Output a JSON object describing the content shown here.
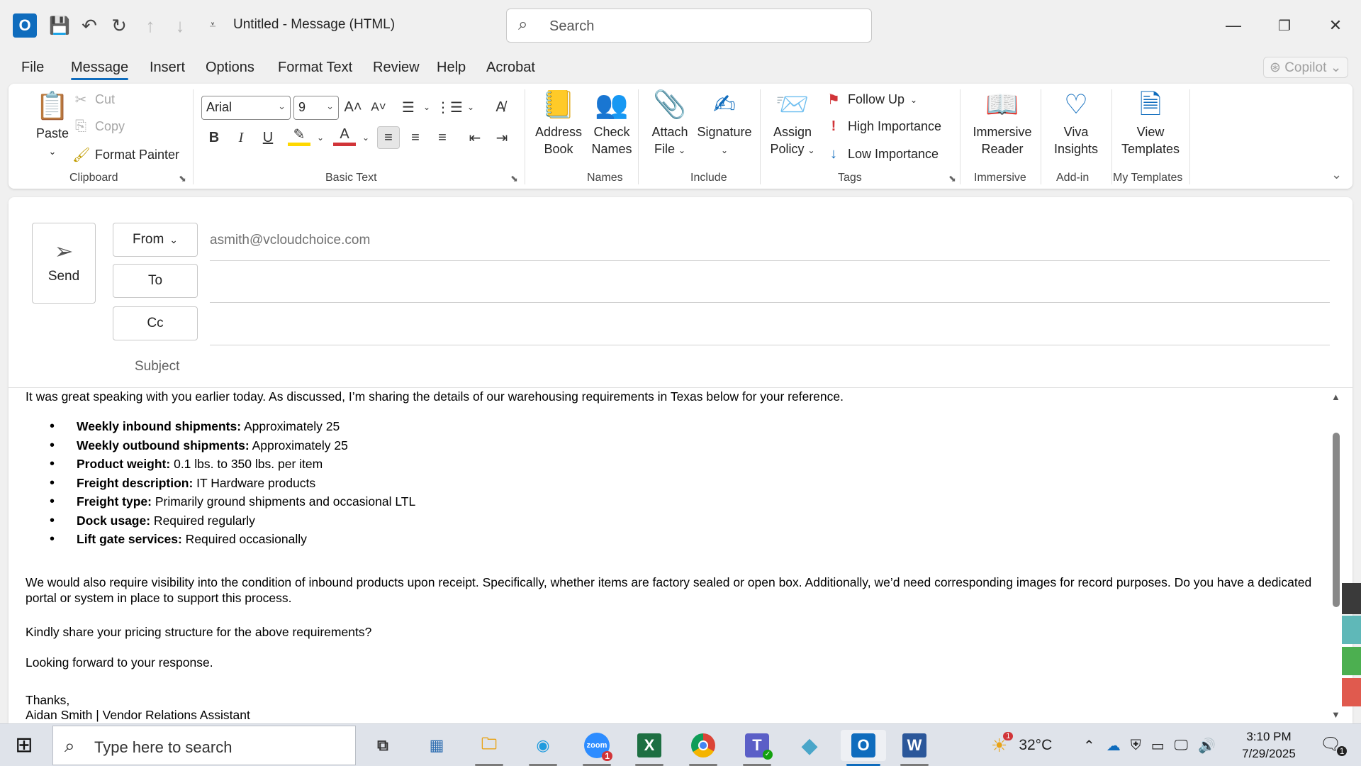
{
  "titlebar": {
    "title": "Untitled  -  Message (HTML)",
    "search_placeholder": "Search"
  },
  "menu": {
    "tabs": [
      "File",
      "Message",
      "Insert",
      "Options",
      "Format Text",
      "Review",
      "Help",
      "Acrobat"
    ],
    "active": "Message",
    "copilot": "Copilot"
  },
  "ribbon": {
    "clipboard": {
      "paste": "Paste",
      "cut": "Cut",
      "copy": "Copy",
      "format_painter": "Format Painter",
      "label": "Clipboard"
    },
    "basic_text": {
      "font": "Arial",
      "size": "9",
      "bold": "B",
      "italic": "I",
      "underline": "U",
      "label": "Basic Text"
    },
    "names": {
      "address_book_1": "Address",
      "address_book_2": "Book",
      "check_names_1": "Check",
      "check_names_2": "Names",
      "label": "Names"
    },
    "include": {
      "attach_1": "Attach",
      "attach_2": "File",
      "signature": "Signature",
      "label": "Include"
    },
    "tags": {
      "assign_1": "Assign",
      "assign_2": "Policy",
      "follow_up": "Follow Up",
      "high": "High Importance",
      "low": "Low Importance",
      "label": "Tags"
    },
    "immersive": {
      "reader_1": "Immersive",
      "reader_2": "Reader",
      "label": "Immersive"
    },
    "addin": {
      "viva_1": "Viva",
      "viva_2": "Insights",
      "label": "Add-in"
    },
    "templates": {
      "view_1": "View",
      "view_2": "Templates",
      "label": "My Templates"
    }
  },
  "compose": {
    "send": "Send",
    "from_label": "From",
    "from_address": "asmith@vcloudchoice.com",
    "to_label": "To",
    "cc_label": "Cc",
    "subject_label": "Subject"
  },
  "body": {
    "intro": "It was great speaking with you earlier today. As discussed, I’m sharing the details of our warehousing requirements in Texas below for your reference.",
    "items": [
      {
        "label": "Weekly inbound shipments:",
        "value": " Approximately 25"
      },
      {
        "label": "Weekly outbound shipments:",
        "value": " Approximately 25"
      },
      {
        "label": "Product weight:",
        "value": " 0.1 lbs. to 350 lbs. per item"
      },
      {
        "label": "Freight description:",
        "value": " IT Hardware products"
      },
      {
        "label": "Freight type:",
        "value": " Primarily ground shipments and occasional LTL"
      },
      {
        "label": "Dock usage:",
        "value": " Required regularly"
      },
      {
        "label": "Lift gate services:",
        "value": " Required occasionally"
      }
    ],
    "para1": "We would also require visibility into the condition of inbound products upon receipt. Specifically, whether items are factory sealed or open box. Additionally, we’d need corresponding images for record purposes. Do you have a dedicated portal or system in place to support this process.",
    "para2": "Kindly share your pricing structure for the above requirements?",
    "para3": "Looking forward to your response.",
    "closing": "Thanks,",
    "signature": "Aidan Smith | Vendor Relations Assistant"
  },
  "taskbar": {
    "search_placeholder": "Type here to search",
    "weather": "32°C",
    "weather_badge": "1",
    "zoom_badge": "1",
    "time": "3:10 PM",
    "date": "7/29/2025",
    "notif_count": "1"
  },
  "colors": {
    "accent": "#0f6cbd",
    "excel": "#1d6f42",
    "word": "#2b579a",
    "teams": "#5b5fc7"
  }
}
